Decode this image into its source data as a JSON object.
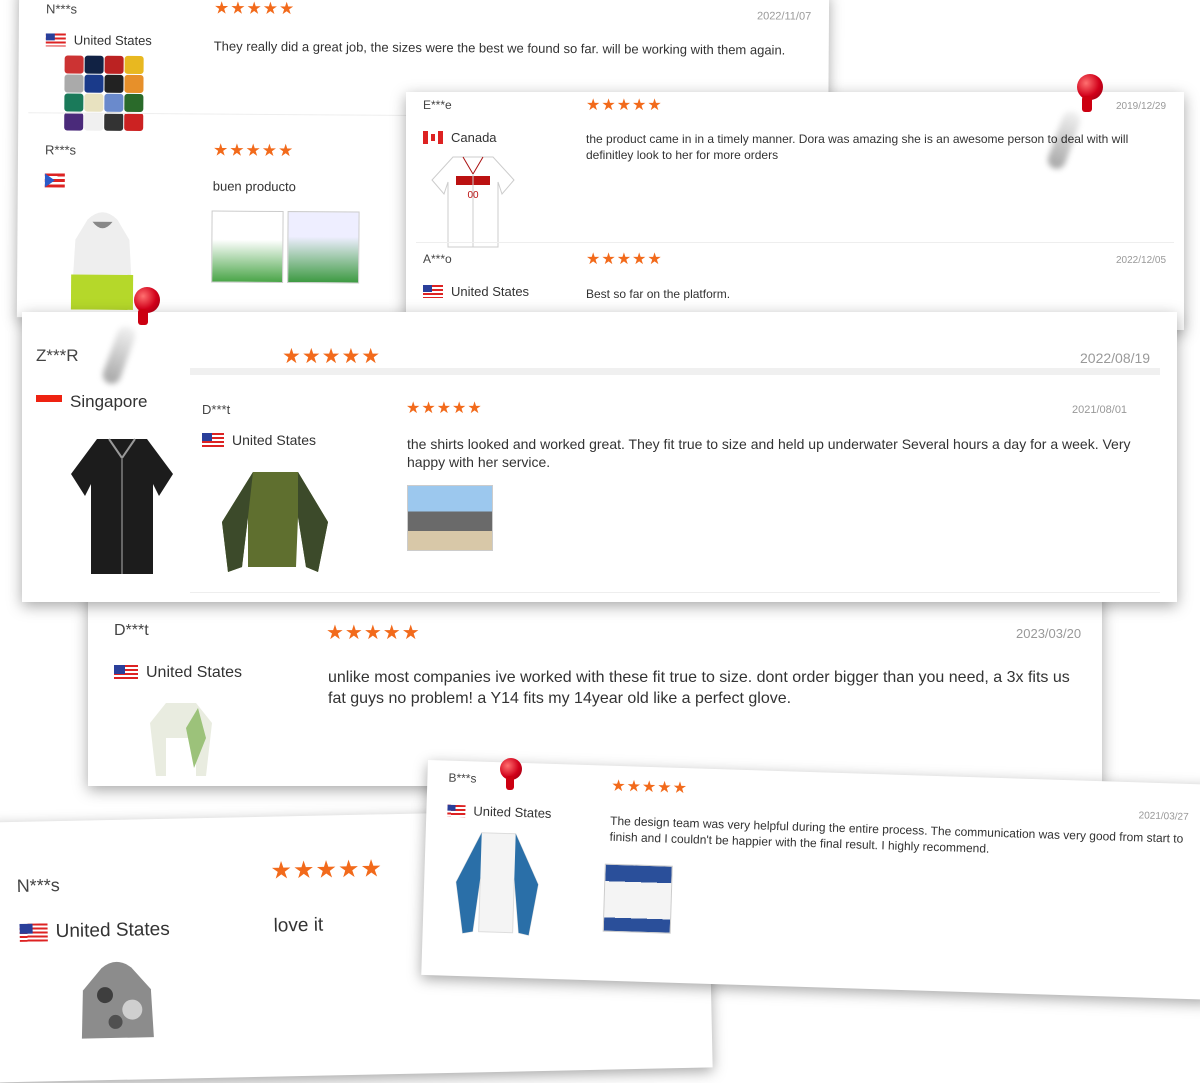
{
  "cards": {
    "c1": {
      "name": "N***s",
      "stars": "★★★★★",
      "date": "2022/11/07",
      "country": "United States",
      "text": "They really did a great job, the sizes were the best we found so far. will be working with them again.",
      "name2": "R***s",
      "stars2": "★★★★★",
      "text2": "buen producto"
    },
    "c2": {
      "name": "E***e",
      "stars": "★★★★★",
      "date": "2019/12/29",
      "country": "Canada",
      "text": "the product came in in a timely manner. Dora was amazing she is an awesome person to deal with will definitley look to her for more orders",
      "name2": "A***o",
      "stars2": "★★★★★",
      "date2": "2022/12/05",
      "country2": "United States",
      "text2": "Best so far on the platform."
    },
    "c3": {
      "name": "Z***R",
      "stars": "★★★★★",
      "date": "2022/08/19",
      "country": "Singapore",
      "name2": "D***t",
      "stars2": "★★★★★",
      "date2": "2021/08/01",
      "country2": "United States",
      "text2": "the shirts looked and worked great. They fit true to size and held up underwater Several hours a day for a week. Very happy with her service."
    },
    "c4": {
      "name": "D***t",
      "stars": "★★★★★",
      "date": "2023/03/20",
      "country": "United States",
      "text": "unlike most companies ive worked with these fit true to size. dont order bigger than you need, a 3x fits us fat guys no problem! a Y14 fits my 14year old like a perfect glove."
    },
    "c5": {
      "name": "N***s",
      "stars": "★★★★★",
      "country": "United States",
      "text": "love it"
    },
    "c6": {
      "name": "B***s",
      "stars": "★★★★★",
      "date": "2021/03/27",
      "country": "United States",
      "text": "The design team was very helpful during the entire process. The communication was very good from start to finish and I couldn't be happier with the final result. I highly recommend."
    }
  },
  "colors": {
    "star": "#f26a1b",
    "pin": "#d1001a"
  }
}
